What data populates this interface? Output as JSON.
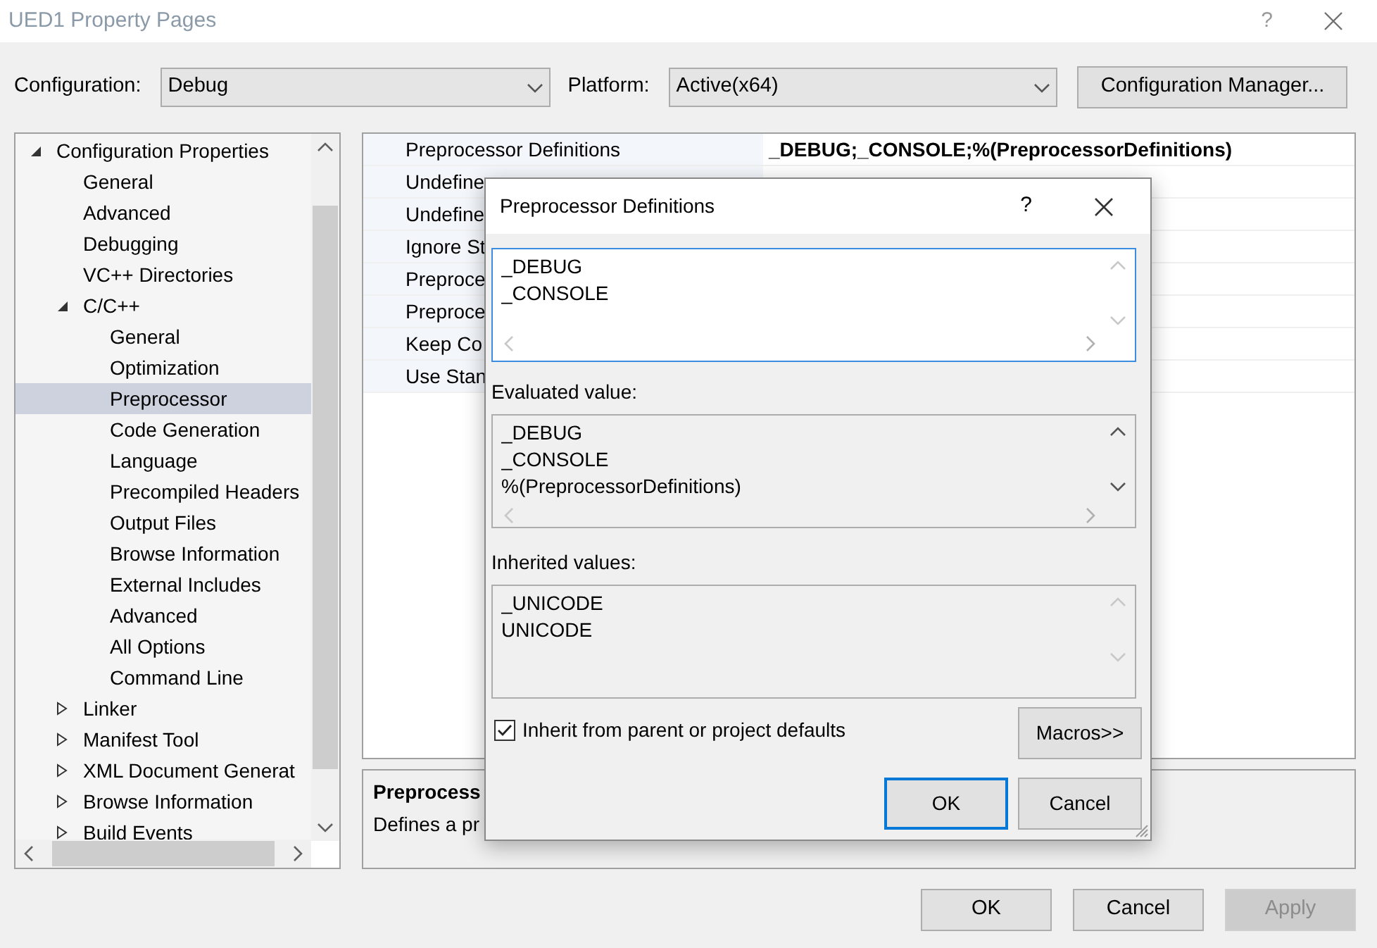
{
  "window": {
    "title": "UED1 Property Pages",
    "help": "?"
  },
  "toolbar": {
    "configuration_label": "Configuration:",
    "configuration": "Debug",
    "platform_label": "Platform:",
    "platform": "Active(x64)",
    "manager_button": "Configuration Manager..."
  },
  "tree": [
    {
      "label": "Configuration Properties",
      "expanded": true,
      "selected": false,
      "children": [
        {
          "label": "General",
          "selected": false
        },
        {
          "label": "Advanced",
          "selected": false
        },
        {
          "label": "Debugging",
          "selected": false
        },
        {
          "label": "VC++ Directories",
          "selected": false
        },
        {
          "label": "C/C++",
          "expanded": true,
          "selected": false,
          "children": [
            {
              "label": "General",
              "selected": false
            },
            {
              "label": "Optimization",
              "selected": false
            },
            {
              "label": "Preprocessor",
              "selected": true
            },
            {
              "label": "Code Generation",
              "selected": false
            },
            {
              "label": "Language",
              "selected": false
            },
            {
              "label": "Precompiled Headers",
              "selected": false
            },
            {
              "label": "Output Files",
              "selected": false
            },
            {
              "label": "Browse Information",
              "selected": false
            },
            {
              "label": "External Includes",
              "selected": false
            },
            {
              "label": "Advanced",
              "selected": false
            },
            {
              "label": "All Options",
              "selected": false
            },
            {
              "label": "Command Line",
              "selected": false
            }
          ]
        },
        {
          "label": "Linker",
          "expanded": false,
          "selected": false
        },
        {
          "label": "Manifest Tool",
          "expanded": false,
          "selected": false
        },
        {
          "label": "XML Document Generat",
          "expanded": false,
          "selected": false
        },
        {
          "label": "Browse Information",
          "expanded": false,
          "selected": false
        },
        {
          "label": "Build Events",
          "expanded": false,
          "selected": false
        }
      ]
    }
  ],
  "grid": [
    {
      "name": "Preprocessor Definitions",
      "value": "_DEBUG;_CONSOLE;%(PreprocessorDefinitions)"
    },
    {
      "name": "Undefine"
    },
    {
      "name": "Undefine"
    },
    {
      "name": "Ignore St"
    },
    {
      "name": "Preproce"
    },
    {
      "name": "Preproce"
    },
    {
      "name": "Keep Co"
    },
    {
      "name": "Use Stan"
    }
  ],
  "description": {
    "title": "Preprocess",
    "text": "Defines a pr"
  },
  "buttons": [
    {
      "label": "OK",
      "disabled": false
    },
    {
      "label": "Cancel",
      "disabled": false
    },
    {
      "label": "Apply",
      "disabled": true
    }
  ],
  "dialog": {
    "title": "Preprocessor Definitions",
    "help": "?",
    "edit_lines": [
      "_DEBUG",
      "_CONSOLE"
    ],
    "evaluated_label": "Evaluated value:",
    "evaluated_lines": [
      "_DEBUG",
      "_CONSOLE",
      "%(PreprocessorDefinitions)"
    ],
    "inherited_label": "Inherited values:",
    "inherited_lines": [
      "_UNICODE",
      "UNICODE"
    ],
    "inherit_checkbox": {
      "label": "Inherit from parent or project defaults",
      "checked": true
    },
    "macros_button": "Macros>>",
    "buttons": [
      {
        "label": "OK",
        "default": true
      },
      {
        "label": "Cancel",
        "default": false
      }
    ]
  }
}
